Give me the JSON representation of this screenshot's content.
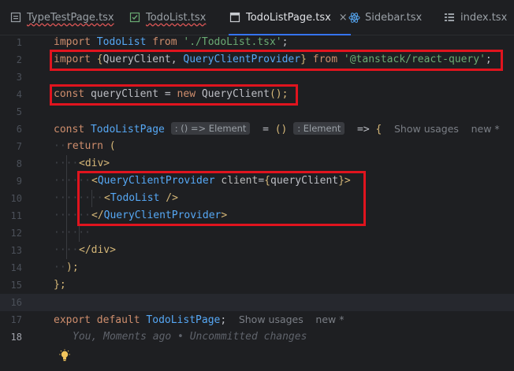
{
  "tabs": [
    {
      "label": "TypeTestPage.tsx",
      "icon": "file-icon",
      "error": true
    },
    {
      "label": "TodoList.tsx",
      "icon": "react-file-icon",
      "error": true
    },
    {
      "label": "TodoListPage.tsx",
      "icon": "file-icon",
      "active": true,
      "close": "×"
    },
    {
      "label": "Sidebar.tsx",
      "icon": "react-icon"
    },
    {
      "label": "index.tsx",
      "icon": "list-file-icon"
    }
  ],
  "line_numbers": [
    "1",
    "2",
    "3",
    "4",
    "5",
    "6",
    "7",
    "8",
    "9",
    "10",
    "11",
    "12",
    "13",
    "14",
    "15",
    "16",
    "17",
    "18"
  ],
  "code": {
    "l1": {
      "import": "import",
      "name": "TodoList",
      "from": "from",
      "path": "'./TodoList.tsx'",
      "semi": ";"
    },
    "l2": {
      "import": "import",
      "open": "{",
      "a": "QueryClient",
      "comma": ",",
      "b": "QueryClientProvider",
      "close": "}",
      "from": "from",
      "path": "'@tanstack/react-query'",
      "semi": ";"
    },
    "l4": {
      "const": "const",
      "name": "queryClient",
      "eq": "=",
      "new": "new",
      "cls": "QueryClient",
      "call": "();"
    },
    "l6": {
      "const": "const",
      "name": "TodoListPage",
      "hint1": ": () => Element",
      "eq": "=",
      "arrow_open": "()",
      "hint2": ": Element",
      "arrow": "=>",
      "brace": "{",
      "usages": "Show usages",
      "new_badge": "new *"
    },
    "l7": {
      "return": "return",
      "paren": "("
    },
    "l8": {
      "tag": "<div>"
    },
    "l9": {
      "open": "<",
      "comp": "QueryClientProvider",
      "attr": "client",
      "eq": "=",
      "brace_open": "{",
      "val": "queryClient",
      "brace_close": "}",
      "close": ">"
    },
    "l10": {
      "open": "<",
      "comp": "TodoList",
      "close": "/>"
    },
    "l11": {
      "open": "</",
      "comp": "QueryClientProvider",
      "close": ">"
    },
    "l13": {
      "tag": "</div>"
    },
    "l14": {
      "paren": ");"
    },
    "l15": {
      "brace": "};"
    },
    "l17": {
      "export": "export",
      "default": "default",
      "name": "TodoListPage",
      "semi": ";",
      "usages": "Show usages",
      "new_badge": "new *"
    },
    "l18": {
      "blame": "You, Moments ago • Uncommitted changes"
    }
  },
  "colors": {
    "highlight_box": "#e0141e",
    "keyword": "#cf8e6d",
    "string": "#6aab73",
    "function": "#56a8f5",
    "tag": "#d5b778"
  }
}
